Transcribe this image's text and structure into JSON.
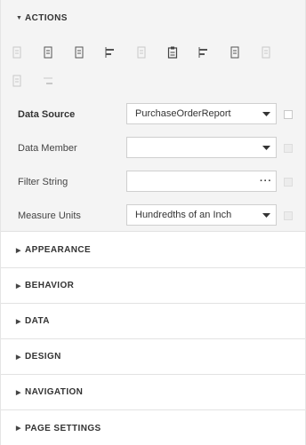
{
  "sections": {
    "actions": "ACTIONS",
    "appearance": "APPEARANCE",
    "behavior": "BEHAVIOR",
    "data": "DATA",
    "design": "DESIGN",
    "navigation": "NAVIGATION",
    "page_settings": "PAGE SETTINGS"
  },
  "properties": {
    "data_source": {
      "label": "Data Source",
      "value": "PurchaseOrderReport"
    },
    "data_member": {
      "label": "Data Member",
      "value": ""
    },
    "filter_string": {
      "label": "Filter String",
      "value": "",
      "button": "···"
    },
    "measure_units": {
      "label": "Measure Units",
      "value": "Hundredths of an Inch"
    }
  },
  "toolbar_icons": [
    "align-left-icon",
    "align-center-icon",
    "align-right-icon",
    "align-lefts-icon",
    "page-icon",
    "clipboard-icon",
    "align-rights-icon",
    "align-middle-icon",
    "align-bottom-icon",
    "size-to-grid-icon",
    "align-tops-icon"
  ]
}
